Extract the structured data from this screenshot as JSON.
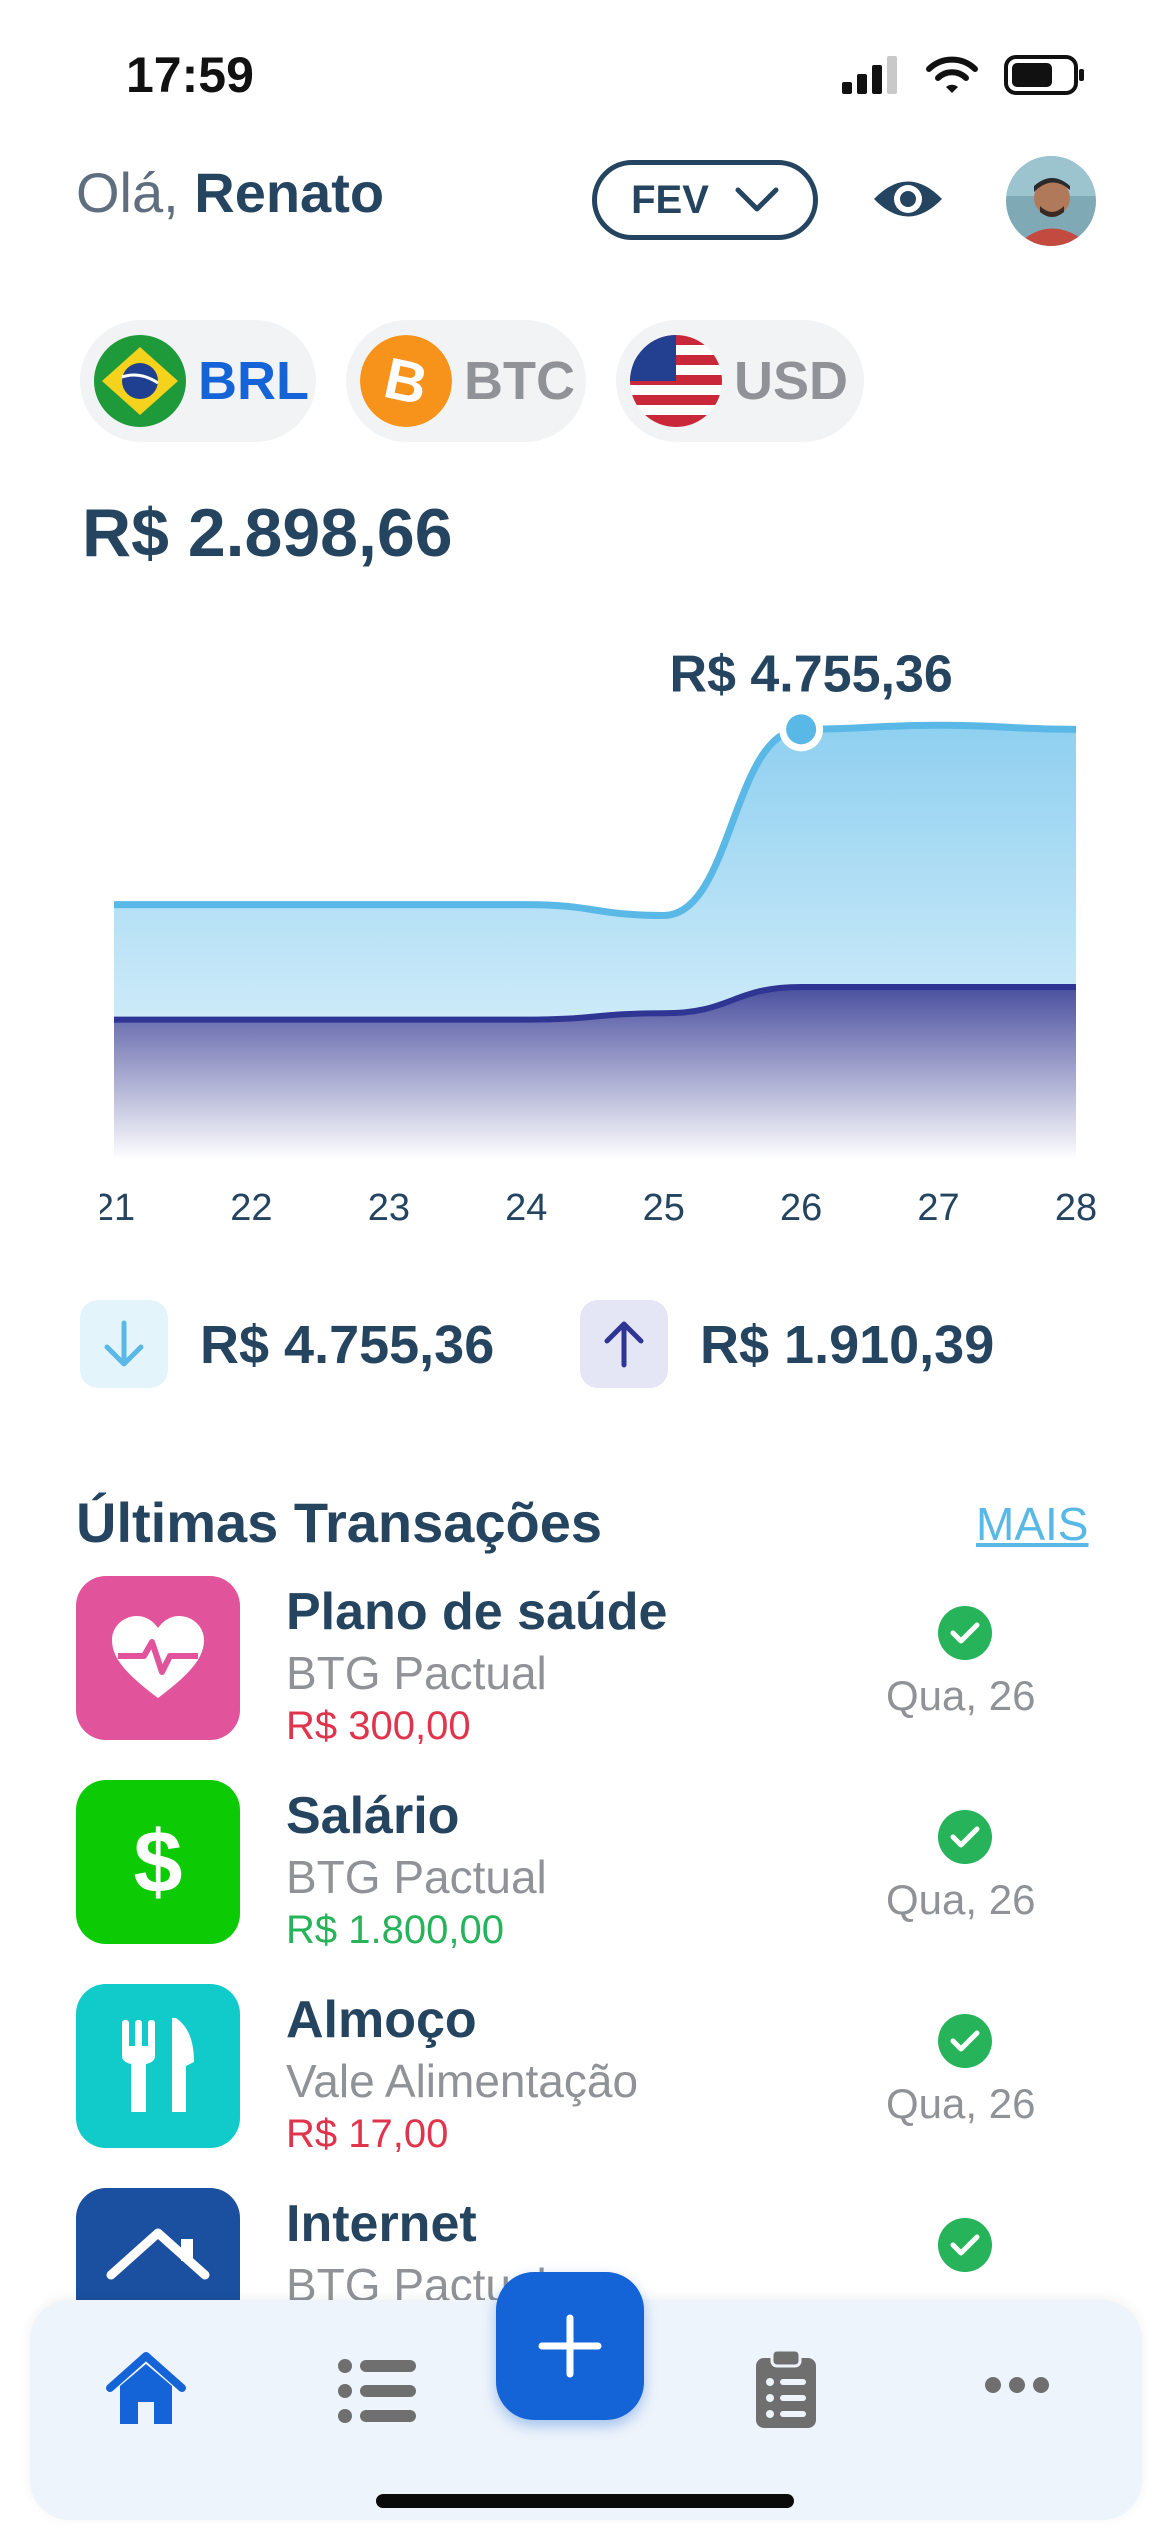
{
  "status_bar": {
    "time": "17:59"
  },
  "header": {
    "greeting_prefix": "Olá,",
    "user_name": "Renato",
    "month_selector": "FEV"
  },
  "currencies": [
    {
      "code": "BRL",
      "color": "#1464d8",
      "selected": true
    },
    {
      "code": "BTC",
      "color": "#8f9397",
      "selected": false
    },
    {
      "code": "USD",
      "color": "#8f9397",
      "selected": false
    }
  ],
  "balance": "R$ 2.898,66",
  "chart_data": {
    "type": "area",
    "x": [
      "21",
      "22",
      "23",
      "24",
      "25",
      "26",
      "27",
      "28"
    ],
    "series": [
      {
        "values": [
          2820,
          2820,
          2820,
          2820,
          2700,
          4755.36,
          4800,
          4755.36
        ],
        "color": "#5ab8e6"
      },
      {
        "values": [
          1550,
          1550,
          1550,
          1550,
          1620,
          1910.39,
          1910.39,
          1910.39
        ],
        "color": "#2f3592"
      }
    ],
    "highlight": {
      "x": "26",
      "label": "R$ 4.755,36"
    },
    "ylim": [
      0,
      5300
    ],
    "grid": false
  },
  "summary": {
    "income": {
      "value": "R$ 4.755,36",
      "icon": "arrow-down-icon",
      "color": "#5ab8e6"
    },
    "expense": {
      "value": "R$ 1.910,39",
      "icon": "arrow-up-icon",
      "color": "#2f3592"
    }
  },
  "transactions_section": {
    "title": "Últimas Transações",
    "more_label": "MAIS"
  },
  "transactions": [
    {
      "title": "Plano de saúde",
      "account": "BTG Pactual",
      "amount": "R$ 300,00",
      "amount_color": "#e0344c",
      "date": "Qua, 26",
      "icon": "heart-pulse-icon",
      "icon_bg": "#e1539a"
    },
    {
      "title": "Salário",
      "account": "BTG Pactual",
      "amount": "R$ 1.800,00",
      "amount_color": "#27b35a",
      "date": "Qua, 26",
      "icon": "dollar-icon",
      "icon_bg": "#0ccb04"
    },
    {
      "title": "Almoço",
      "account": "Vale Alimentação",
      "amount": "R$ 17,00",
      "amount_color": "#e0344c",
      "date": "Qua, 26",
      "icon": "fork-knife-icon",
      "icon_bg": "#10cbc9"
    },
    {
      "title": "Internet",
      "account": "BTG Pactual",
      "amount": "",
      "amount_color": "#e0344c",
      "date": "",
      "icon": "house-icon",
      "icon_bg": "#1b4fa0"
    }
  ],
  "bottom_nav": {
    "items": [
      "home-icon",
      "list-icon",
      "add-icon",
      "clipboard-icon",
      "more-icon"
    ],
    "active": "home-icon"
  }
}
